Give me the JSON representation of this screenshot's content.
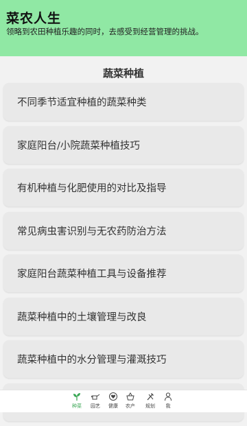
{
  "header": {
    "title": "菜农人生",
    "subtitle": "领略到农田种植乐趣的同时，去感受到经营管理的挑战。"
  },
  "section": {
    "title": "蔬菜种植"
  },
  "list": {
    "items": [
      {
        "label": "不同季节适宜种植的蔬菜种类"
      },
      {
        "label": "家庭阳台/小院蔬菜种植技巧"
      },
      {
        "label": "有机种植与化肥使用的对比及指导"
      },
      {
        "label": "常见病虫害识别与无农药防治方法"
      },
      {
        "label": "家庭阳台蔬菜种植工具与设备推荐"
      },
      {
        "label": "蔬菜种植中的土壤管理与改良"
      },
      {
        "label": "蔬菜种植中的水分管理与灌溉技巧"
      }
    ]
  },
  "bottom_nav": {
    "items": [
      {
        "label": "种菜",
        "icon": "sprout-icon",
        "active": true
      },
      {
        "label": "园艺",
        "icon": "watering-can-icon",
        "active": false
      },
      {
        "label": "健康",
        "icon": "heart-circle-icon",
        "active": false
      },
      {
        "label": "农产",
        "icon": "basket-icon",
        "active": false
      },
      {
        "label": "规划",
        "icon": "tools-icon",
        "active": false
      },
      {
        "label": "我",
        "icon": "person-icon",
        "active": false
      }
    ]
  },
  "colors": {
    "header_bg": "#90e8a4",
    "accent": "#3aa755",
    "card_bg": "#e9e9e9"
  }
}
